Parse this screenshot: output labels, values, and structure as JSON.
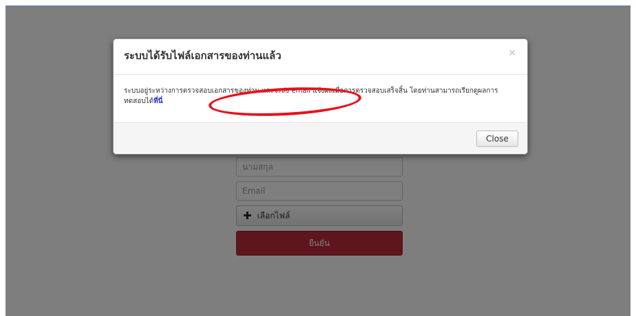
{
  "form": {
    "lastname_placeholder": "นามสกุล",
    "email_placeholder": "Email",
    "file_button_label": "เลือกไฟล์",
    "submit_label": "ยืนยัน"
  },
  "modal": {
    "title": "ระบบได้รับไฟล์เอกสารของท่านแล้ว",
    "close_symbol": "×",
    "body_text": "ระบบอยู่ระหว่างการตรวจสอบเอกสารของท่าน และจะส่ง email แจ้งผลเมื่อการตรวจสอบเสร็จสิ้น โดยท่านสามารถเรียกดูผลการทดสอบได้",
    "body_link": "ที่นี่",
    "close_button": "Close"
  },
  "colors": {
    "submit": "#bd2c38",
    "annotation": "#e8111a",
    "link": "#2030d0"
  }
}
